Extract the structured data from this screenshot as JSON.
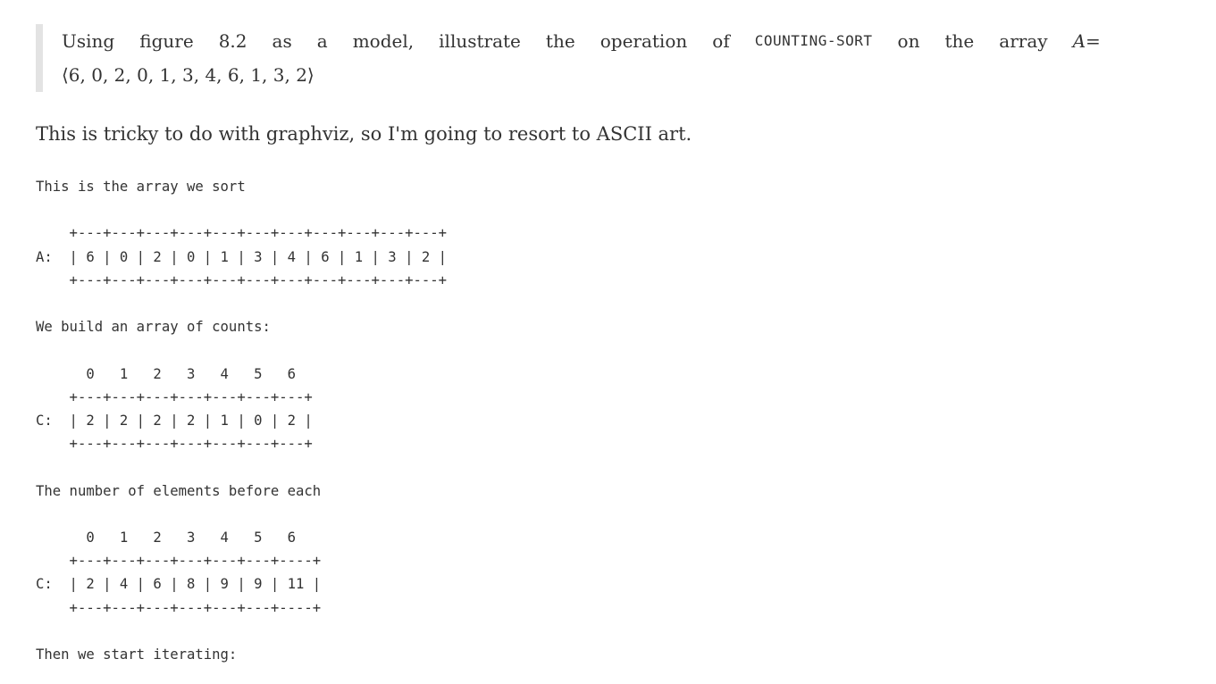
{
  "quote": {
    "words": [
      "Using",
      "figure",
      "8.2",
      "as",
      "a",
      "model,",
      "illustrate",
      "the",
      "operation",
      "of"
    ],
    "algorithm": "COUNTING-SORT",
    "words_after": [
      "on",
      "the",
      "array"
    ],
    "math_var": "A",
    "math_eq": "=",
    "math_sequence": "⟨6, 0, 2, 0, 1, 3, 4, 6, 1, 3, 2⟩"
  },
  "intro": "This is tricky to do with graphviz, so I'm going to resort to ASCII art.",
  "code_text": "This is the array we sort\n\n    +---+---+---+---+---+---+---+---+---+---+---+\nA:  | 6 | 0 | 2 | 0 | 1 | 3 | 4 | 6 | 1 | 3 | 2 |\n    +---+---+---+---+---+---+---+---+---+---+---+\n\nWe build an array of counts:\n\n      0   1   2   3   4   5   6\n    +---+---+---+---+---+---+---+\nC:  | 2 | 2 | 2 | 2 | 1 | 0 | 2 |\n    +---+---+---+---+---+---+---+\n\nThe number of elements before each\n\n      0   1   2   3   4   5   6\n    +---+---+---+---+---+---+----+\nC:  | 2 | 4 | 6 | 8 | 9 | 9 | 11 |\n    +---+---+---+---+---+---+----+\n\nThen we start iterating:"
}
